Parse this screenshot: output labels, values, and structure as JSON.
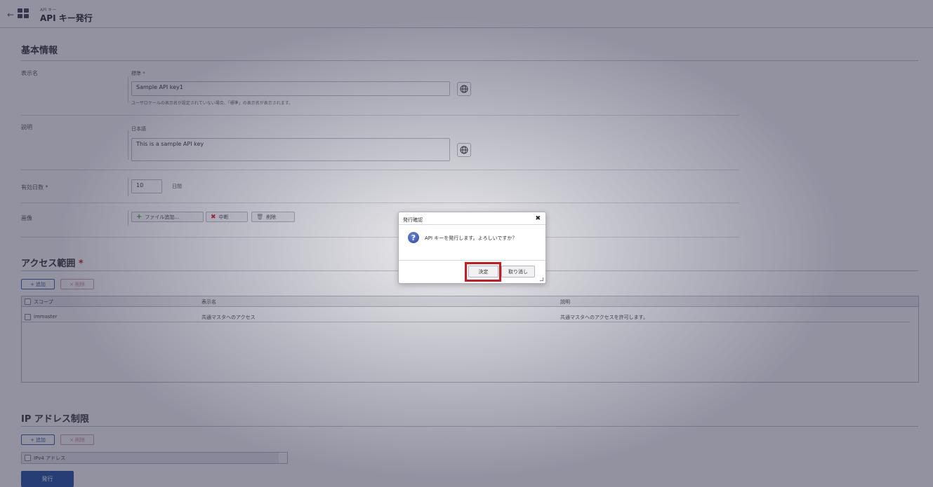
{
  "header": {
    "subtitle": "API キー",
    "title": "API キー発行"
  },
  "basic_info": {
    "section_title": "基本情報",
    "display_name": {
      "label": "表示名",
      "locale_label": "標準 *",
      "value": "Sample API key1",
      "hint": "ユーザロケールの表示名が設定されていない場合、「標準」の表示名が表示されます。"
    },
    "description": {
      "label": "説明",
      "locale_label": "日本語",
      "value": "This is a sample API key"
    },
    "valid_days": {
      "label": "有効日数 *",
      "value": "10",
      "unit": "日間"
    },
    "image": {
      "label": "画像",
      "add_file_label": "ファイル追加...",
      "cancel_label": "中断",
      "delete_label": "削除"
    }
  },
  "access_scope": {
    "section_title": "アクセス範囲",
    "required_mark": "*",
    "add_label": "追加",
    "delete_label": "削除",
    "columns": [
      "スコープ",
      "表示名",
      "説明"
    ],
    "rows": [
      {
        "scope": "immaster",
        "display_name": "共通マスタへのアクセス",
        "description": "共通マスタへのアクセスを許可します。"
      }
    ]
  },
  "ip_restriction": {
    "section_title": "IP アドレス制限",
    "add_label": "追加",
    "delete_label": "削除",
    "column": "IPv4 アドレス"
  },
  "submit_label": "発行",
  "dialog": {
    "title": "発行確認",
    "message": "API キーを発行します。よろしいですか？",
    "ok_label": "決定",
    "cancel_label": "取り消し"
  },
  "colors": {
    "primary": "#1e4fa3",
    "highlight": "#d1161c",
    "add_green": "#3a9a3a",
    "cancel_red": "#cc2222"
  }
}
